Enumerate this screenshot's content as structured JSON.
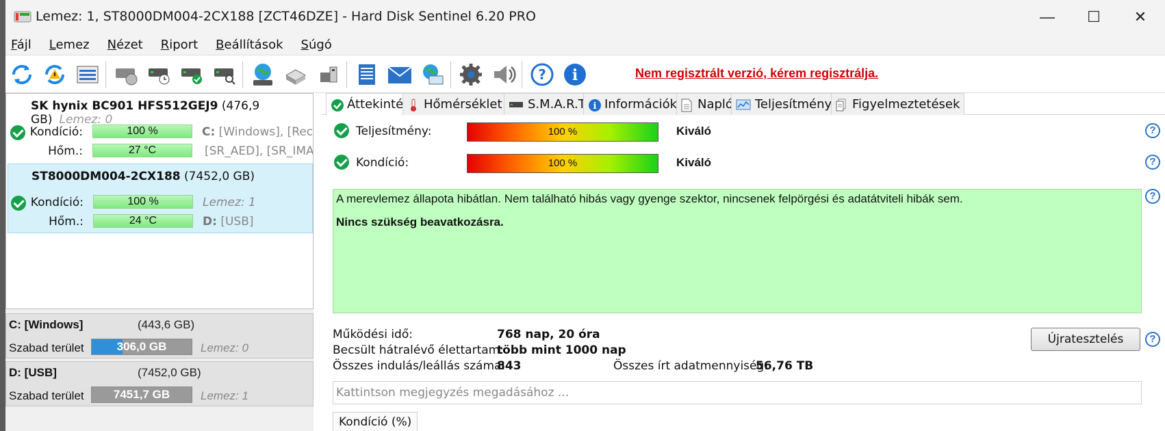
{
  "window": {
    "title": "Lemez: 1, ST8000DM004-2CX188 [ZCT46DZE]  -  Hard Disk Sentinel 6.20 PRO",
    "minimize": "—",
    "maximize": "☐",
    "close": "✕"
  },
  "menu": [
    {
      "u": "F",
      "rest": "ájl"
    },
    {
      "u": "L",
      "rest": "emez"
    },
    {
      "u": "N",
      "rest": "ézet"
    },
    {
      "u": "R",
      "rest": "iport"
    },
    {
      "u": "B",
      "rest": "eállítások"
    },
    {
      "u": "S",
      "rest": "úgó"
    }
  ],
  "toolbar": {
    "register_text": "Nem regisztrált verzió, kérem regisztrálja."
  },
  "disks": [
    {
      "name": "SK hynix BC901 HFS512GEJ9",
      "size": "(476,9 GB)",
      "lemez": "Lemez: 0",
      "kondicio_label": "Kondíció:",
      "kondicio": "100 %",
      "hom_label": "Hőm.:",
      "hom": "27 °C",
      "info1_drive": "C:",
      "info1_rest": " [Windows],  [Reco",
      "info2": "[SR_AED],  [SR_IMAG"
    },
    {
      "name": "ST8000DM004-2CX188",
      "size": "(7452,0 GB)",
      "kondicio_label": "Kondíció:",
      "kondicio": "100 %",
      "hom_label": "Hőm.:",
      "hom": "24 °C",
      "info1": "Lemez: 1",
      "info2_drive": "D:",
      "info2_rest": " [USB]"
    }
  ],
  "volumes": [
    {
      "name": "C: [Windows]",
      "size": "(443,6 GB)",
      "free_label": "Szabad terület",
      "free": "306,0 GB",
      "free_ratio": 0.31,
      "fill_color": "#2f8fd8",
      "disk": "Lemez: 0"
    },
    {
      "name": "D: [USB]",
      "size": "(7452,0 GB)",
      "free_label": "Szabad terület",
      "free": "7451,7 GB",
      "free_ratio": 0.0,
      "fill_color": "#2f8fd8",
      "disk": "Lemez: 1"
    }
  ],
  "tabs": [
    {
      "label": "Áttekintés",
      "icon": "check-icon"
    },
    {
      "label": "Hőmérséklet",
      "icon": "thermometer-icon"
    },
    {
      "label": "S.M.A.R.T.",
      "icon": "drive-icon"
    },
    {
      "label": "Információk",
      "icon": "info-icon"
    },
    {
      "label": "Napló",
      "icon": "document-icon"
    },
    {
      "label": "Teljesítmény",
      "icon": "chart-icon"
    },
    {
      "label": "Figyelmeztetések",
      "icon": "warnings-icon"
    }
  ],
  "overview": {
    "performance_label": "Teljesítmény:",
    "performance_value": "100 %",
    "performance_rating": "Kiváló",
    "condition_label": "Kondíció:",
    "condition_value": "100 %",
    "condition_rating": "Kiváló",
    "status_line1": "A merevlemez állapota hibátlan. Nem található hibás vagy gyenge szektor, nincsenek felpörgési és adatátviteli hibák sem.",
    "status_line2": "Nincs szükség beavatkozásra.",
    "uptime_label": "Működési idő:",
    "uptime_value": "768 nap, 20 óra",
    "lifetime_label": "Becsült hátralévő élettartam:",
    "lifetime_value": "több mint 1000 nap",
    "startstop_label": "Összes indulás/leállás száma:",
    "startstop_value": "843",
    "written_label": "Összes írt adatmennyiség:",
    "written_value": "56,76 TB",
    "retest_button": "Újratesztelés",
    "note_placeholder": "Kattintson megjegyzés megadásához ...",
    "kondicio_tab": "Kondíció  (%)",
    "help": "?"
  }
}
